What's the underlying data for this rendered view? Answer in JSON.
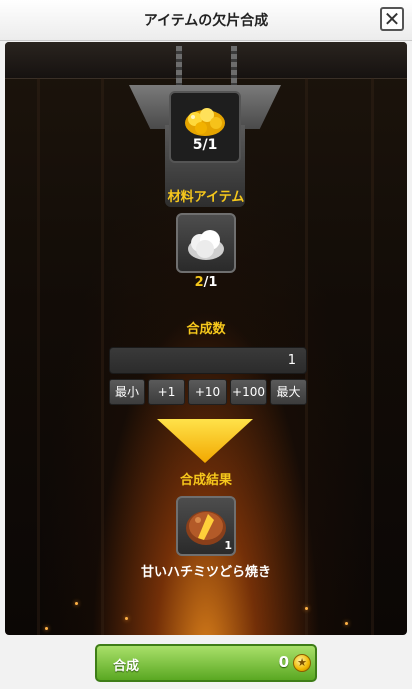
{
  "header": {
    "title": "アイテムの欠片合成",
    "close_label": "✕"
  },
  "target_item": {
    "icon": "gold-honey-fragment-icon",
    "have": "5",
    "sep": "/",
    "need": "1"
  },
  "materials": {
    "heading": "材料アイテム",
    "item": {
      "icon": "white-powder-icon",
      "have": "2",
      "sep": "/",
      "need": "1"
    }
  },
  "quantity": {
    "heading": "合成数",
    "value": "1",
    "buttons": [
      "最小",
      "+1",
      "+10",
      "+100",
      "最大"
    ]
  },
  "result": {
    "heading": "合成結果",
    "icon": "honey-dorayaki-icon",
    "count": "1",
    "name": "甘いハチミツどら焼き"
  },
  "synthesize": {
    "label": "合成",
    "cost": "0",
    "currency_icon": "star-coin-icon"
  },
  "colors": {
    "accent_yellow": "#f6c81c",
    "button_green": "#5aa822"
  }
}
